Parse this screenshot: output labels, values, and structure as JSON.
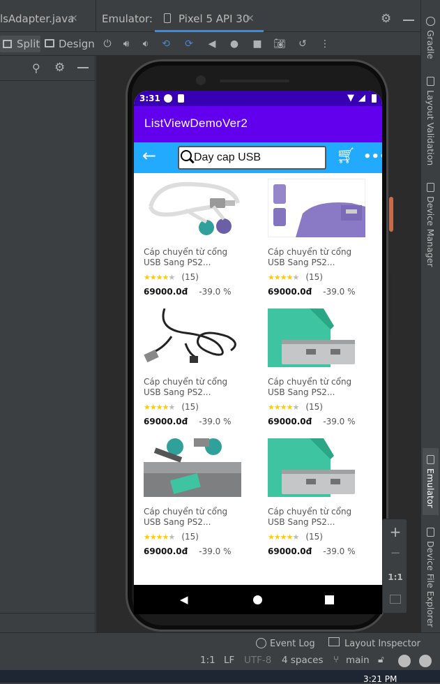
{
  "ide": {
    "editor_tab": "lsAdapter.java",
    "emulator_label": "Emulator:",
    "device_tab": "Pixel 5 API 30",
    "view_split": "Split",
    "view_design": "Design",
    "right_tabs": [
      "Gradle",
      "Layout Validation",
      "Device Manager",
      "Emulator",
      "Device File Explorer"
    ],
    "bottom_tools": {
      "event_log": "Event Log",
      "layout_inspector": "Layout Inspector"
    },
    "status": {
      "position": "1:1",
      "line_sep": "LF",
      "encoding": "UTF-8",
      "indent": "4 spaces",
      "branch": "main"
    },
    "taskbar_time": "3:21 PM",
    "zoom": {
      "in": "+",
      "out": "−",
      "actual": "1:1"
    }
  },
  "app": {
    "status_time": "3:31",
    "title": "ListViewDemoVer2",
    "search_text": "Day cap USB",
    "products": [
      {
        "name": "Cáp chuyển từ cổng USB Sang PS2...",
        "rating_count": "(15)",
        "price": "69000.0đ",
        "discount": "-39.0 %",
        "stars": 4,
        "image": "usb-ps2-splitter-white"
      },
      {
        "name": "Cáp chuyển từ cổng USB Sang PS2...",
        "rating_count": "(15)",
        "price": "69000.0đ",
        "discount": "-39.0 %",
        "stars": 4,
        "image": "usb-ps2-adapter-purple"
      },
      {
        "name": "Cáp chuyển từ cổng USB Sang PS2...",
        "rating_count": "(15)",
        "price": "69000.0đ",
        "discount": "-39.0 %",
        "stars": 4,
        "image": "usb-cable-black"
      },
      {
        "name": "Cáp chuyển từ cổng USB Sang PS2...",
        "rating_count": "(15)",
        "price": "69000.0đ",
        "discount": "-39.0 %",
        "stars": 4,
        "image": "usb-adapter-green"
      },
      {
        "name": "Cáp chuyển từ cổng USB Sang PS2...",
        "rating_count": "(15)",
        "price": "69000.0đ",
        "discount": "-39.0 %",
        "stars": 4,
        "image": "usb-ps2-adapter-laptop"
      },
      {
        "name": "Cáp chuyển từ cổng USB Sang PS2...",
        "rating_count": "(15)",
        "price": "69000.0đ",
        "discount": "-39.0 %",
        "stars": 4,
        "image": "usb-adapter-green"
      }
    ]
  },
  "colors": {
    "status_bar": "#3700b3",
    "app_bar": "#6200ee",
    "search_bar": "#22aaff",
    "star": "#ffcc00",
    "ide_bg": "#3c3f41"
  }
}
